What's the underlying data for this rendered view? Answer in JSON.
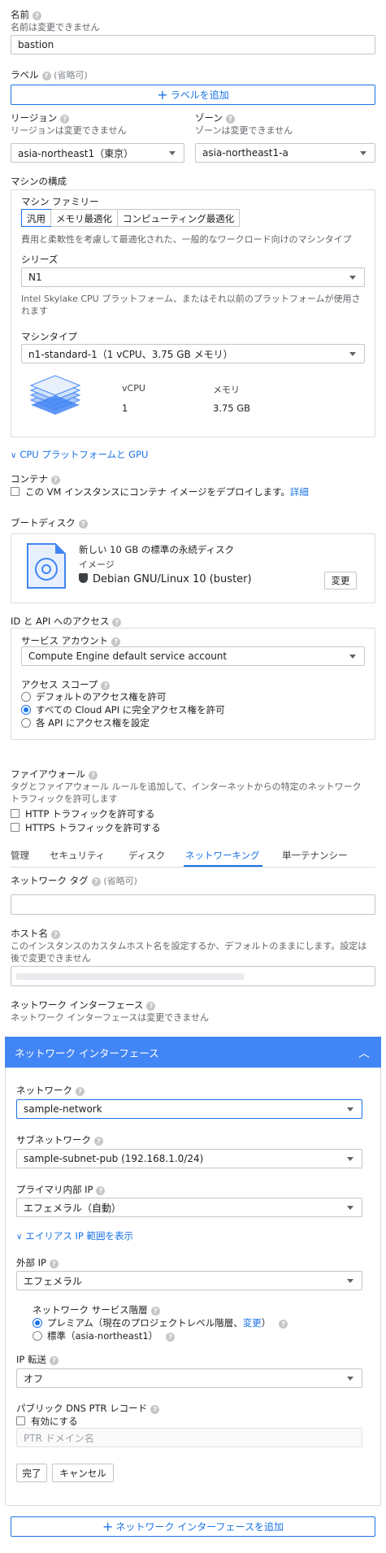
{
  "name": {
    "label": "名前",
    "hint": "名前は変更できません",
    "value": "bastion"
  },
  "labels": {
    "label": "ラベル",
    "optional": "(省略可)",
    "add_button": "ラベルを追加"
  },
  "region": {
    "label": "リージョン",
    "hint": "リージョンは変更できません",
    "value": "asia-northeast1（東京）"
  },
  "zone": {
    "label": "ゾーン",
    "hint": "ゾーンは変更できません",
    "value": "asia-northeast1-a"
  },
  "machine_config": {
    "title": "マシンの構成",
    "family_label": "マシン ファミリー",
    "family_tabs": [
      "汎用",
      "メモリ最適化",
      "コンピューティング最適化"
    ],
    "family_desc": "費用と柔軟性を考慮して最適化された、一般的なワークロード向けのマシンタイプ",
    "series_label": "シリーズ",
    "series_value": "N1",
    "series_desc_line1": "Intel Skylake CPU プラットフォーム、またはそれ以前のプラットフォームが使用さ",
    "series_desc_line2": "れます",
    "type_label": "マシンタイプ",
    "type_value": "n1-standard-1（1 vCPU、3.75 GB メモリ）",
    "vcpu_header": "vCPU",
    "memory_header": "メモリ",
    "vcpu_value": "1",
    "memory_value": "3.75 GB"
  },
  "cpu_platform_link": "CPU プラットフォームと GPU",
  "container": {
    "label": "コンテナ",
    "checkbox_text": "この VM インスタンスにコンテナ イメージをデプロイします。",
    "details_link": "詳細"
  },
  "boot_disk": {
    "label": "ブートディスク",
    "title": "新しい 10 GB の標準の永続ディスク",
    "image_label": "イメージ",
    "os": "Debian GNU/Linux 10 (buster)",
    "change_button": "変更"
  },
  "api_access": {
    "label": "ID と API へのアクセス",
    "service_account_label": "サービス アカウント",
    "service_account_value": "Compute Engine default service account",
    "scope_label": "アクセス スコープ",
    "scope_options": [
      "デフォルトのアクセス権を許可",
      "すべての Cloud API に完全アクセス権を許可",
      "各 API にアクセス権を設定"
    ]
  },
  "firewall": {
    "label": "ファイアウォール",
    "desc_line1": "タグとファイアウォール ルールを追加して、インターネットからの特定のネットワーク",
    "desc_line2": "トラフィックを許可します",
    "http": "HTTP トラフィックを許可する",
    "https": "HTTPS トラフィックを許可する"
  },
  "tabs": [
    "管理",
    "セキュリティ",
    "ディスク",
    "ネットワーキング",
    "単一テナンシー"
  ],
  "network_tags": {
    "label": "ネットワーク タグ",
    "optional": "(省略可)"
  },
  "hostname": {
    "label": "ホスト名",
    "desc_line1": "このインスタンスのカスタムホスト名を設定するか、デフォルトのままにします。設定は",
    "desc_line2": "後で変更できません"
  },
  "net_if_section": {
    "label": "ネットワーク インターフェース",
    "hint": "ネットワーク インターフェースは変更できません"
  },
  "net_if_panel": {
    "header": "ネットワーク インターフェース",
    "network_label": "ネットワーク",
    "network_value": "sample-network",
    "subnet_label": "サブネットワーク",
    "subnet_value": "sample-subnet-pub (192.168.1.0/24)",
    "primary_ip_label": "プライマリ内部 IP",
    "primary_ip_value": "エフェメラル（自動）",
    "alias_link": "エイリアス IP 範囲を表示",
    "external_ip_label": "外部 IP",
    "external_ip_value": "エフェメラル",
    "tier_label": "ネットワーク サービス階層",
    "tier_premium": "プレミアム（現在のプロジェクトレベル階層、",
    "tier_change": "変更",
    "tier_premium_end": "）",
    "tier_standard": "標準（asia-northeast1）",
    "ip_forward_label": "IP 転送",
    "ip_forward_value": "オフ",
    "dns_label": "パブリック DNS PTR レコード",
    "dns_enable": "有効にする",
    "ptr_placeholder": "PTR ドメイン名",
    "done_button": "完了",
    "cancel_button": "キャンセル"
  },
  "add_net_if_button": "ネットワーク インターフェースを追加"
}
